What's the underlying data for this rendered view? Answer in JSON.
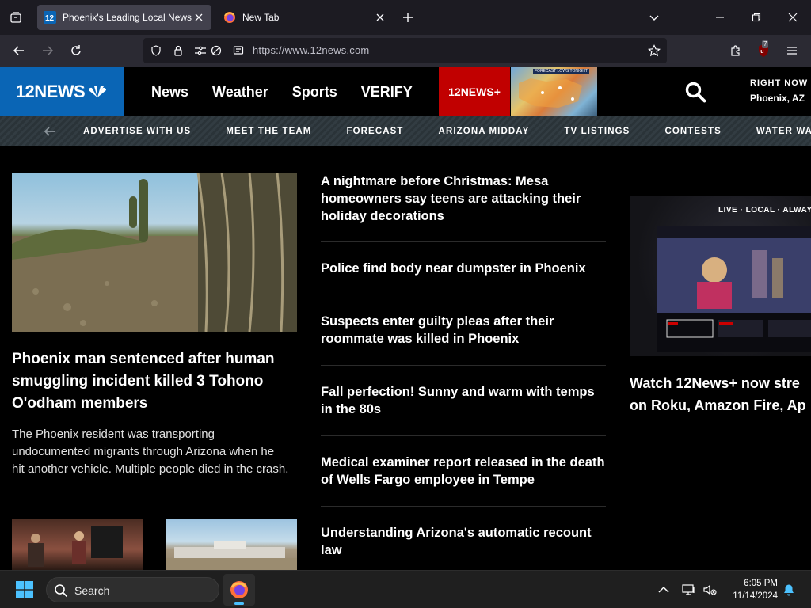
{
  "browser": {
    "tabs": [
      {
        "title": "Phoenix's Leading Local News: ",
        "active": true
      },
      {
        "title": "New Tab",
        "active": false
      }
    ],
    "url": "https://www.12news.com",
    "extension_badge": "7"
  },
  "site": {
    "logo_text": "12NEWS",
    "nav": [
      "News",
      "Weather",
      "Sports",
      "VERIFY"
    ],
    "plus_label": "12NEWS+",
    "weather_thumb_label": "FORECAST LOWS TONIGHT",
    "right_now_label": "RIGHT NOW",
    "right_now_location": "Phoenix, AZ",
    "subnav": [
      "ADVERTISE WITH US",
      "MEET THE TEAM",
      "FORECAST",
      "ARIZONA MIDDAY",
      "TV LISTINGS",
      "CONTESTS",
      "WATER WA"
    ]
  },
  "lead_story": {
    "title": "Phoenix man sentenced after human smuggling incident killed 3 Tohono O'odham members",
    "summary": "The Phoenix resident was transporting undocumented migrants through Arizona when he hit another vehicle. Multiple people died in the crash."
  },
  "headlines": [
    "A nightmare before Christmas: Mesa homeowners say teens are attacking their holiday decorations",
    "Police find body near dumpster in Phoenix",
    "Suspects enter guilty pleas after their roommate was killed in Phoenix",
    "Fall perfection! Sunny and warm with temps in the 80s",
    "Medical examiner report released in the death of Wells Fargo employee in Tempe",
    "Understanding Arizona's automatic recount law"
  ],
  "promo": {
    "tagline": "LIVE · LOCAL · ALWAYS",
    "title_line1": "Watch 12News+ now stre",
    "title_line2": "on Roku, Amazon Fire, Ap"
  },
  "taskbar": {
    "search_label": "Search",
    "time": "6:05 PM",
    "date": "11/14/2024"
  }
}
